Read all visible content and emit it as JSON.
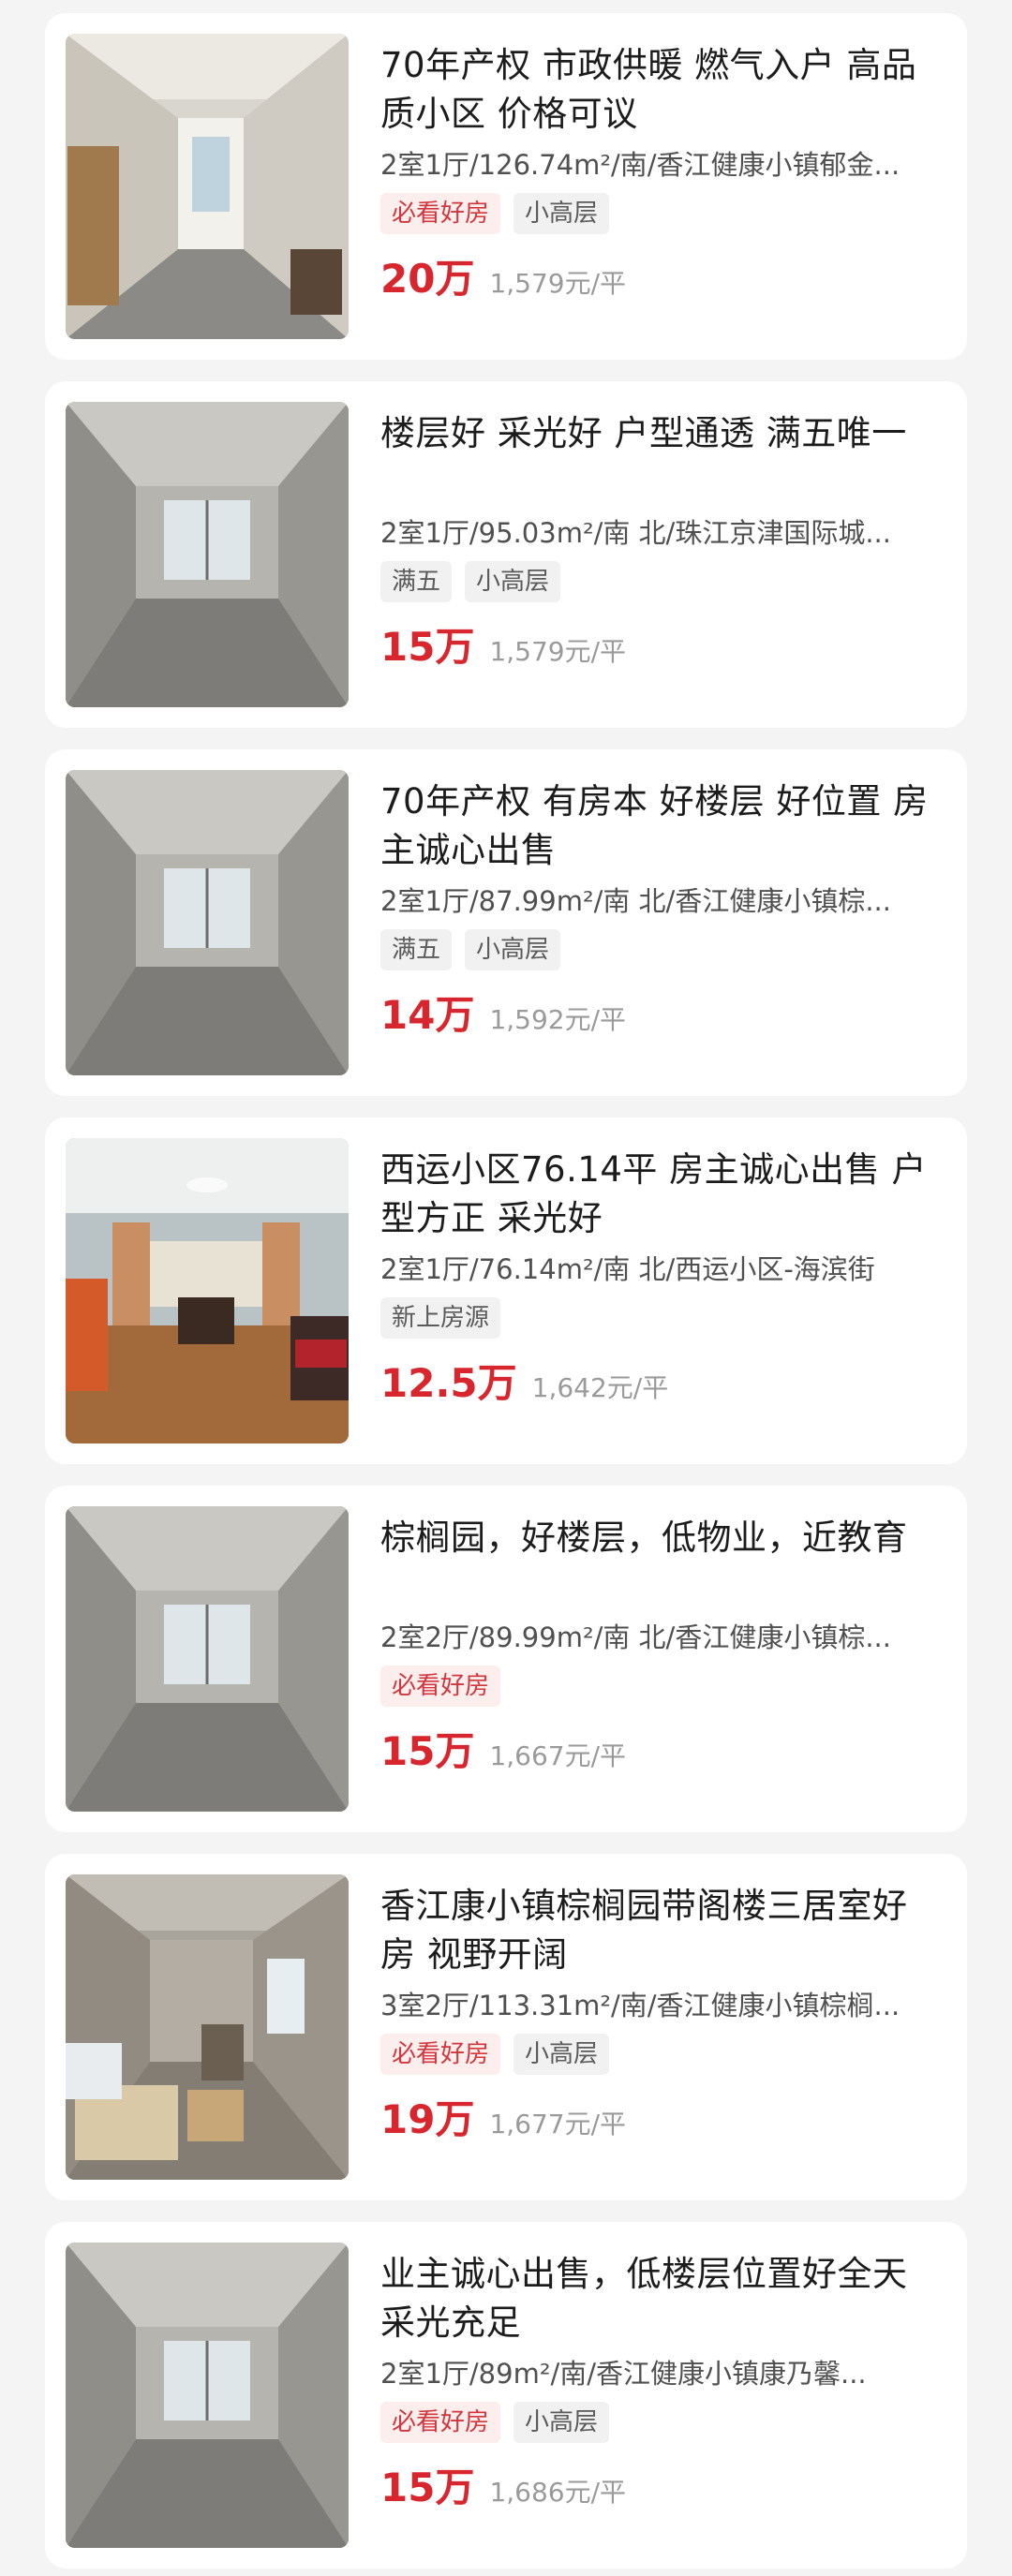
{
  "listings": [
    {
      "title": "70年产权 市政供暖 燃气入户 高品质小区 价格可议",
      "meta": "2室1厅/126.74m²/南/香江健康小镇郁金...",
      "tags": [
        "必看好房",
        "小高层"
      ],
      "price": "20万",
      "unit_price": "1,579元/平",
      "thumb": "photo-unfurnished-hallway"
    },
    {
      "title": "楼层好  采光好  户型通透  满五唯一",
      "meta": "2室1厅/95.03m²/南 北/珠江京津国际城...",
      "tags": [
        "满五",
        "小高层"
      ],
      "price": "15万",
      "unit_price": "1,579元/平",
      "thumb": "photo-concrete-room"
    },
    {
      "title": "70年产权 有房本 好楼层 好位置 房主诚心出售",
      "meta": "2室1厅/87.99m²/南 北/香江健康小镇棕...",
      "tags": [
        "满五",
        "小高层"
      ],
      "price": "14万",
      "unit_price": "1,592元/平",
      "thumb": "photo-concrete-room"
    },
    {
      "title": "西运小区76.14平 房主诚心出售 户型方正 采光好",
      "meta": "2室1厅/76.14m²/南 北/西运小区-海滨街",
      "tags": [
        "新上房源"
      ],
      "price": "12.5万",
      "unit_price": "1,642元/平",
      "thumb": "photo-furnished-livingroom"
    },
    {
      "title": "棕榈园，好楼层，低物业，近教育",
      "meta": "2室2厅/89.99m²/南 北/香江健康小镇棕...",
      "tags": [
        "必看好房"
      ],
      "price": "15万",
      "unit_price": "1,667元/平",
      "thumb": "photo-concrete-room"
    },
    {
      "title": "香江康小镇棕榈园带阁楼三居室好房   视野开阔",
      "meta": "3室2厅/113.31m²/南/香江健康小镇棕榈...",
      "tags": [
        "必看好房",
        "小高层"
      ],
      "price": "19万",
      "unit_price": "1,677元/平",
      "thumb": "photo-room-with-boxes"
    },
    {
      "title": "业主诚心出售，低楼层位置好全天采光充足",
      "meta": "2室1厅/89m²/南/香江健康小镇康乃馨...",
      "tags": [
        "必看好房",
        "小高层"
      ],
      "price": "15万",
      "unit_price": "1,686元/平",
      "thumb": "photo-concrete-room"
    }
  ],
  "colors": {
    "price": "#d8262e",
    "hot_tag_bg": "#fdeeee",
    "hot_tag_text": "#d2363c",
    "tag_bg": "#f1f1f1",
    "page_bg": "#f4f4f5"
  }
}
